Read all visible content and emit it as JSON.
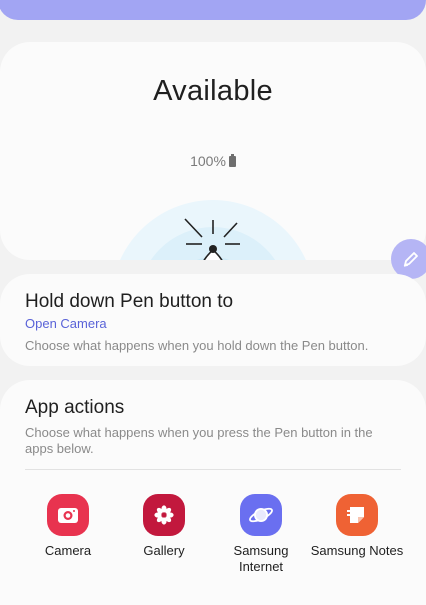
{
  "status": {
    "title": "Available",
    "battery": "100%"
  },
  "hold": {
    "title": "Hold down Pen button to",
    "value": "Open Camera",
    "description": "Choose what happens when you hold down the Pen button."
  },
  "app_actions": {
    "title": "App actions",
    "description": "Choose what happens when you press the Pen button in the apps below.",
    "apps": [
      {
        "label": "Camera",
        "icon": "camera-icon",
        "color": "#e8334f"
      },
      {
        "label": "Gallery",
        "icon": "flower-icon",
        "color": "#c2183d"
      },
      {
        "label": "Samsung Internet",
        "icon": "planet-icon",
        "color": "#6a6ff0"
      },
      {
        "label": "Samsung Notes",
        "icon": "note-icon",
        "color": "#ef6234"
      }
    ]
  },
  "colors": {
    "accent": "#5a63d8",
    "top_bar": "#a2a5f3",
    "float_button": "#b5b5f5"
  }
}
